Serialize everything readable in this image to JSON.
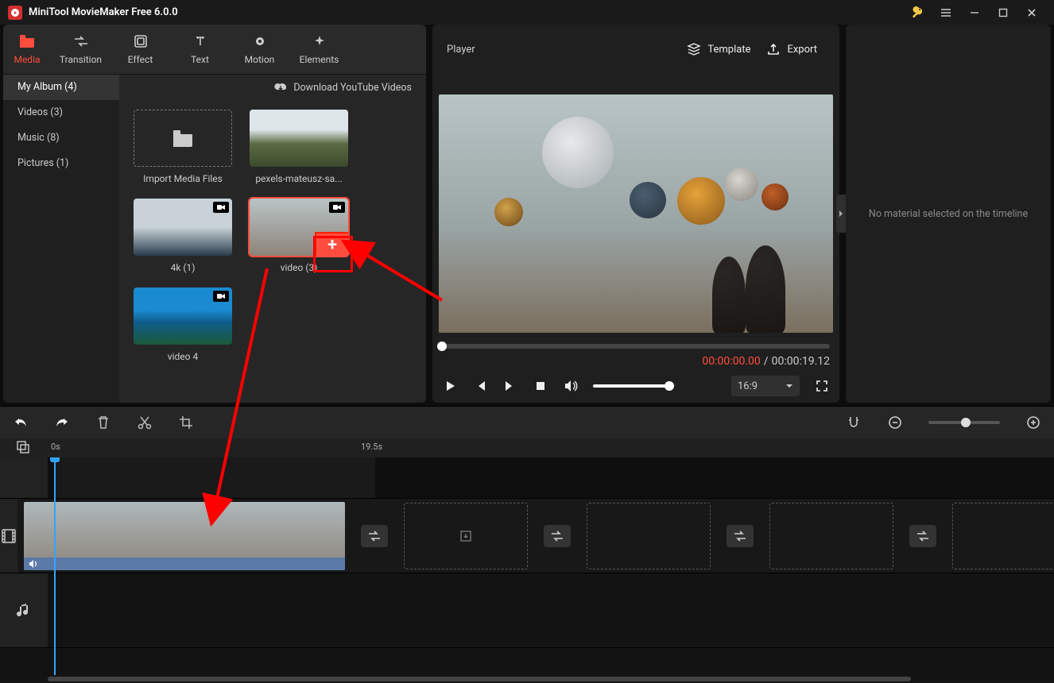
{
  "title_bar": {
    "app_title": "MiniTool MovieMaker Free 6.0.0"
  },
  "tool_tabs": [
    {
      "id": "media",
      "label": "Media",
      "active": true
    },
    {
      "id": "transition",
      "label": "Transition"
    },
    {
      "id": "effect",
      "label": "Effect"
    },
    {
      "id": "text",
      "label": "Text"
    },
    {
      "id": "motion",
      "label": "Motion"
    },
    {
      "id": "elements",
      "label": "Elements"
    }
  ],
  "side_nav": [
    {
      "label": "My Album (4)",
      "active": true
    },
    {
      "label": "Videos (3)"
    },
    {
      "label": "Music (8)"
    },
    {
      "label": "Pictures (1)"
    }
  ],
  "media_area": {
    "download_link": "Download YouTube Videos",
    "import_label": "Import Media Files",
    "items": [
      {
        "label": "pexels-mateusz-sa...",
        "video": false
      },
      {
        "label": "4k (1)",
        "video": true
      },
      {
        "label": "video (3)",
        "video": true,
        "selected": true,
        "add": true
      },
      {
        "label": "video 4",
        "video": true
      }
    ]
  },
  "player": {
    "header_label": "Player",
    "template_label": "Template",
    "export_label": "Export",
    "current_time": "00:00:00.00",
    "separator": "/",
    "duration": "00:00:19.12",
    "ratio": "16:9"
  },
  "inspector": {
    "empty_message": "No material selected on the timeline"
  },
  "timeline": {
    "ruler": {
      "m0": "0s",
      "m1": "19.5s"
    }
  }
}
